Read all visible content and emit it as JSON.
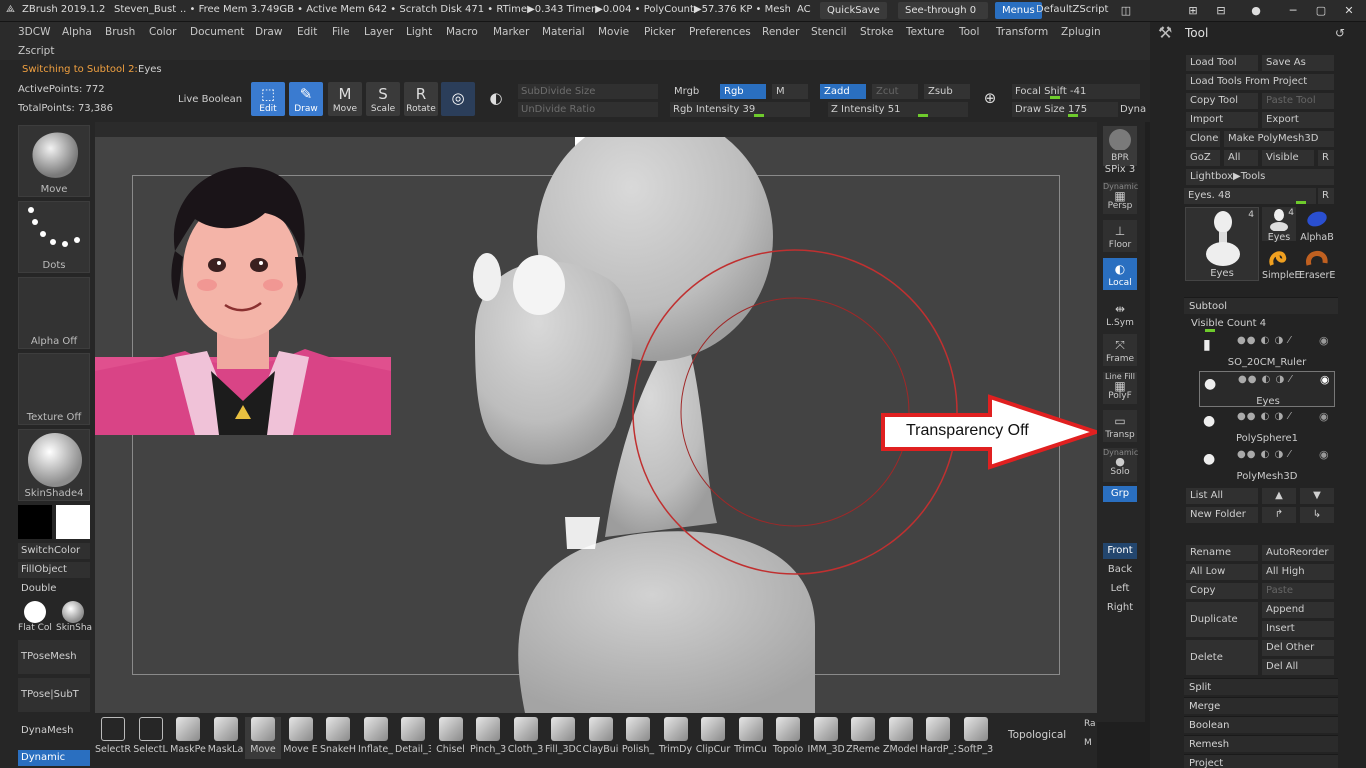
{
  "titlebar": {
    "app": "ZBrush 2019.1.2",
    "project": "Steven_Bust",
    "stats": ".. • Free Mem 3.749GB • Active Mem 642 • Scratch Disk 471 • RTime▶0.343 Timer▶0.004 • PolyCount▶57.376 KP • MeshCo",
    "ac": "AC",
    "quicksave": "QuickSave",
    "seethrough": "See-through  0",
    "menus": "Menus",
    "script": "DefaultZScript"
  },
  "menus": [
    "3DCW",
    "Alpha",
    "Brush",
    "Color",
    "Document",
    "Draw",
    "Edit",
    "File",
    "Layer",
    "Light",
    "Macro",
    "Marker",
    "Material",
    "Movie",
    "Picker",
    "Preferences",
    "Render",
    "Stencil",
    "Stroke",
    "Texture",
    "Tool",
    "Transform",
    "Zplugin"
  ],
  "menus_row2": [
    "Zscript"
  ],
  "notice": {
    "label": "Switching to Subtool 2:",
    "value": "Eyes"
  },
  "points": {
    "active": "ActivePoints: 772",
    "total": "TotalPoints: 73,386"
  },
  "topshelf": {
    "live_boolean": "Live Boolean",
    "tools": [
      {
        "label": "Edit",
        "glyph": "⬚",
        "active": true
      },
      {
        "label": "Draw",
        "glyph": "✎",
        "active": true
      },
      {
        "label": "Move",
        "glyph": "M",
        "active": false
      },
      {
        "label": "Scale",
        "glyph": "S",
        "active": false
      },
      {
        "label": "Rotate",
        "glyph": "R",
        "active": false
      }
    ],
    "subdivide": "SubDivide Size",
    "undivide": "UnDivide Ratio",
    "mrgb": "Mrgb",
    "rgb": "Rgb",
    "m": "M",
    "rgb_intensity": "Rgb Intensity 39",
    "zadd": "Zadd",
    "zcut": "Zcut",
    "zsub": "Zsub",
    "z_intensity": "Z Intensity 51",
    "focal_shift": "Focal Shift -41",
    "draw_size": "Draw Size 175",
    "dyna": "Dyna"
  },
  "leftshelf": {
    "thumbs": [
      "Move",
      "Dots",
      "Alpha Off",
      "Texture Off",
      "SkinShade4"
    ],
    "switchcolor": "SwitchColor",
    "fillobject": "FillObject",
    "double": "Double",
    "flat": "Flat Col",
    "skinsha": "SkinSha",
    "tposemesh": "TPoseMesh",
    "tposesubt": "TPose|SubT",
    "dynamesh": "DynaMesh",
    "dynamic": "Dynamic"
  },
  "viewport": {
    "annotation": "Transparency Off",
    "colors": {
      "annotation": "#e02020",
      "ring": "#c03030",
      "clay": "#bdbdbd"
    }
  },
  "rightbar": {
    "bpr": "BPR",
    "spix": "SPix 3",
    "dynamic": "Dynamic",
    "persp": "Persp",
    "floor": "Floor",
    "local": "Local",
    "lsym": "L.Sym",
    "frame": "Frame",
    "linefill": "Line Fill",
    "polyf": "PolyF",
    "transp": "Transp",
    "dynamic2": "Dynamic",
    "solo": "Solo",
    "grp": "Grp",
    "front": "Front",
    "back": "Back",
    "left": "Left",
    "right": "Right"
  },
  "toolpalette": {
    "title": "Tool",
    "buttons": [
      [
        "Load Tool",
        "Save As"
      ],
      [
        "Load Tools From Project"
      ],
      [
        "Copy Tool",
        "Paste Tool"
      ],
      [
        "Import",
        "Export"
      ],
      [
        "Clone",
        "Make PolyMesh3D"
      ],
      [
        "GoZ",
        "All",
        "Visible",
        "R"
      ],
      [
        "Lightbox▶Tools"
      ]
    ],
    "eyes_slider": "Eyes. 48",
    "r": "R",
    "tool_thumbs": [
      {
        "name": "Eyes",
        "count": "4"
      },
      {
        "name": "Eyes",
        "count": "4"
      },
      {
        "name": "AlphaB",
        "count": ""
      },
      {
        "name": "SimpleE",
        "count": ""
      },
      {
        "name": "EraserE",
        "count": ""
      }
    ],
    "subtool": {
      "title": "Subtool",
      "visible_count": "Visible Count 4",
      "items": [
        "SO_20CM_Ruler",
        "Eyes",
        "PolySphere1",
        "PolyMesh3D"
      ],
      "list_all": "List All",
      "new_folder": "New Folder",
      "rename": "Rename",
      "autoreorder": "AutoReorder",
      "alllow": "All Low",
      "allhigh": "All High",
      "copy": "Copy",
      "paste": "Paste",
      "duplicate": "Duplicate",
      "append": "Append",
      "insert": "Insert",
      "delete": "Delete",
      "delother": "Del Other",
      "delall": "Del All"
    },
    "sections": [
      "Split",
      "Merge",
      "Boolean",
      "Remesh",
      "Project"
    ]
  },
  "bottomshelf": {
    "brushes": [
      "SelectR",
      "SelectL",
      "MaskPe",
      "MaskLa",
      "Move",
      "Move E",
      "SnakeH",
      "Inflate_",
      "Detail_3",
      "Chisel",
      "Pinch_3",
      "Cloth_3",
      "Fill_3DC",
      "ClayBui",
      "Polish_",
      "TrimDy",
      "ClipCur",
      "TrimCu",
      "Topolo",
      "IMM_3D",
      "ZReme",
      "ZModel",
      "HardP_3",
      "SoftP_3"
    ],
    "topological": "Topological",
    "ra": "Ra",
    "m": "M"
  }
}
